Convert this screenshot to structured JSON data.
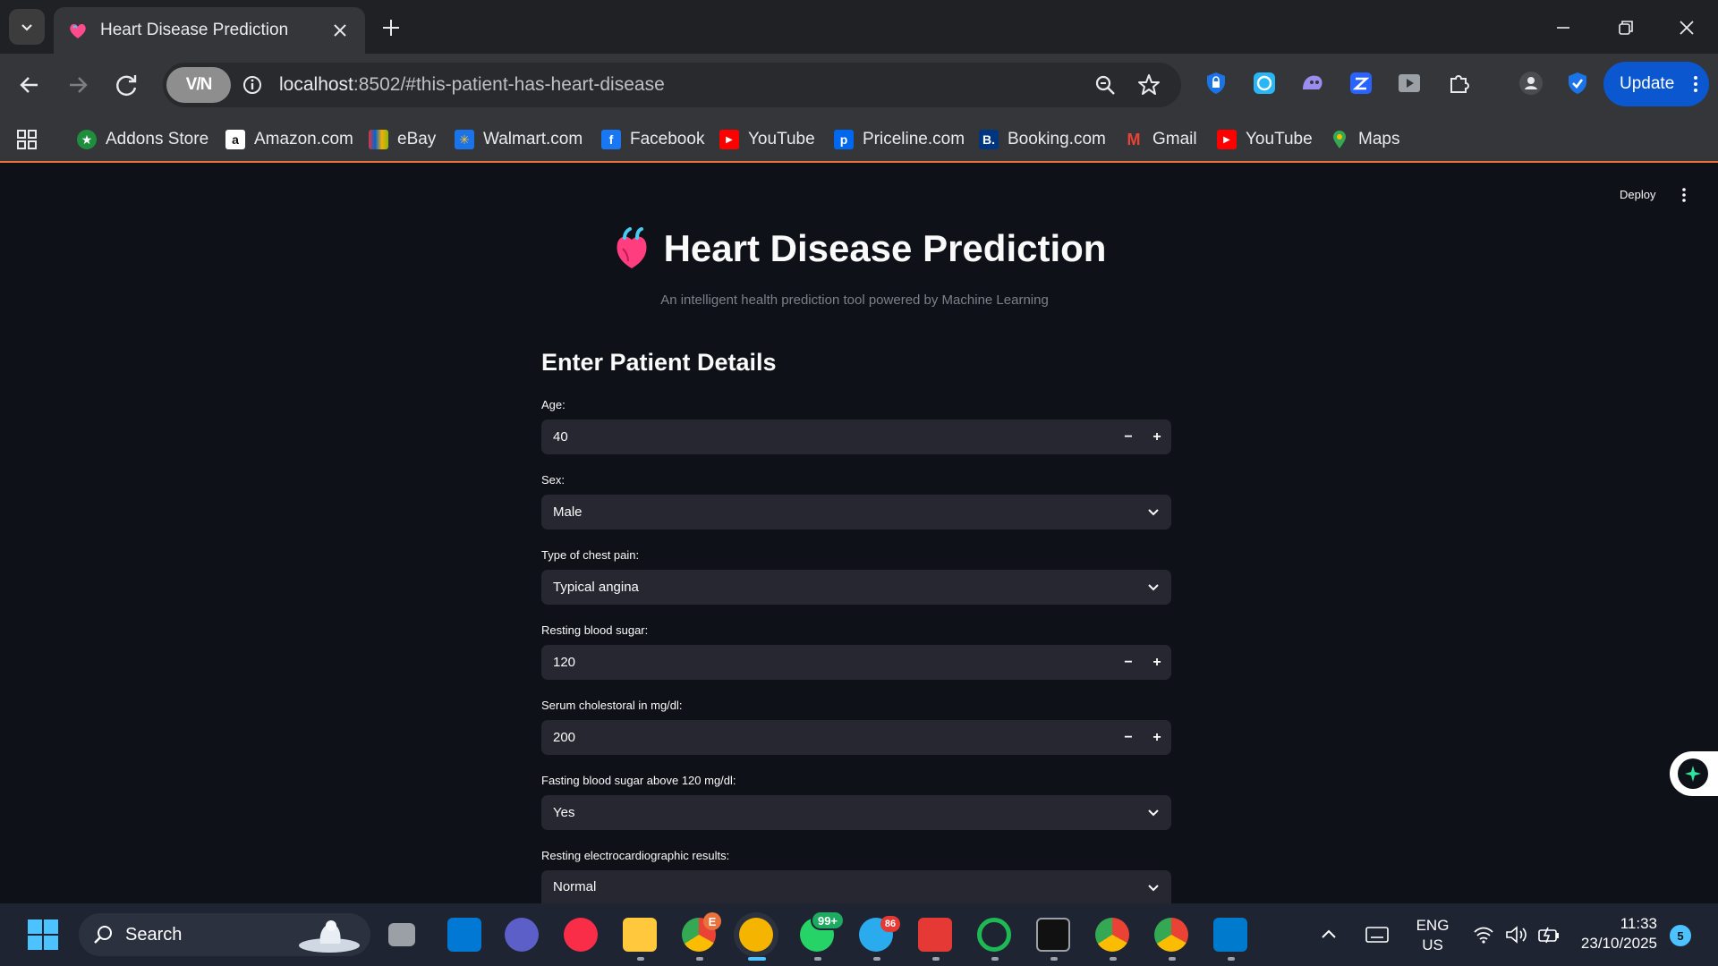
{
  "browser": {
    "tab_title": "Heart Disease Prediction",
    "url_host": "localhost",
    "url_rest": ":8502/#this-patient-has-heart-disease",
    "vpn_label": "V/N",
    "update_label": "Update"
  },
  "bookmarks": [
    {
      "label": "Addons Store",
      "icon": "addons-icon",
      "color": "#1e8e3e"
    },
    {
      "label": "Amazon.com",
      "icon": "amazon-icon",
      "color": "#ffffff"
    },
    {
      "label": "eBay",
      "icon": "ebay-icon",
      "color": "#e53238"
    },
    {
      "label": "Walmart.com",
      "icon": "walmart-icon",
      "color": "#1a73e8"
    },
    {
      "label": "Facebook",
      "icon": "facebook-icon",
      "color": "#1877f2"
    },
    {
      "label": "YouTube",
      "icon": "youtube-icon",
      "color": "#ff0000"
    },
    {
      "label": "Priceline.com",
      "icon": "priceline-icon",
      "color": "#0068ef"
    },
    {
      "label": "Booking.com",
      "icon": "booking-icon",
      "color": "#003580"
    },
    {
      "label": "Gmail",
      "icon": "gmail-icon",
      "color": "#ea4335"
    },
    {
      "label": "YouTube",
      "icon": "youtube-icon",
      "color": "#ff0000"
    },
    {
      "label": "Maps",
      "icon": "maps-icon",
      "color": "#34a853"
    }
  ],
  "app": {
    "deploy_label": "Deploy",
    "title": "Heart Disease Prediction",
    "subtitle": "An intelligent health prediction tool powered by Machine Learning",
    "section_title": "Enter Patient Details",
    "fields": [
      {
        "label": "Age:",
        "value": "40",
        "kind": "number"
      },
      {
        "label": "Sex:",
        "value": "Male",
        "kind": "select"
      },
      {
        "label": "Type of chest pain:",
        "value": "Typical angina",
        "kind": "select"
      },
      {
        "label": "Resting blood sugar:",
        "value": "120",
        "kind": "number"
      },
      {
        "label": "Serum cholestoral in mg/dl:",
        "value": "200",
        "kind": "number"
      },
      {
        "label": "Fasting blood sugar above 120 mg/dl:",
        "value": "Yes",
        "kind": "select"
      },
      {
        "label": "Resting electrocardiographic results:",
        "value": "Normal",
        "kind": "select"
      }
    ]
  },
  "taskbar": {
    "search_label": "Search",
    "whatsapp_badge": "99+",
    "telegram_badge": "86",
    "lang_top": "ENG",
    "lang_bottom": "US",
    "time": "11:33",
    "date": "23/10/2025",
    "notif_count": "5"
  },
  "colors": {
    "accent": "#0b57d0",
    "page_bg": "#0e1117",
    "input_bg": "#262730",
    "loading_bar": "#e8713c"
  }
}
